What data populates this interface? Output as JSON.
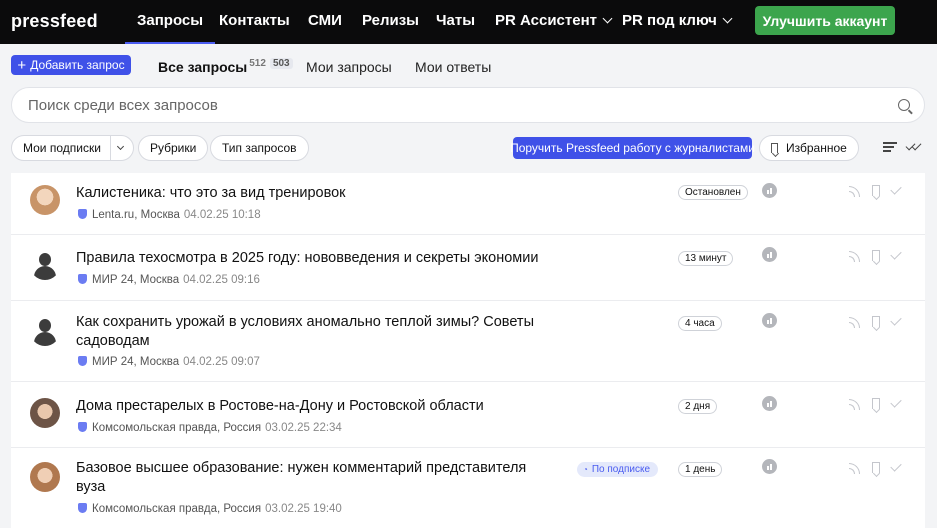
{
  "app": {
    "logo": "pressfeed"
  },
  "nav": {
    "items": [
      {
        "label": "Запросы",
        "active": true
      },
      {
        "label": "Контакты"
      },
      {
        "label": "СМИ"
      },
      {
        "label": "Релизы"
      },
      {
        "label": "Чаты"
      },
      {
        "label": "PR Ассистент",
        "dropdown": true
      },
      {
        "label": "PR под ключ",
        "dropdown": true
      }
    ],
    "upgrade_label": "Улучшить аккаунт"
  },
  "subbar": {
    "add_label": "Добавить запрос",
    "tabs": [
      {
        "label": "Все запросы",
        "count": "512",
        "badge": "503",
        "active": true
      },
      {
        "label": "Мои запросы"
      },
      {
        "label": "Мои ответы"
      }
    ]
  },
  "search": {
    "placeholder": "Поиск среди всех запросов",
    "value": ""
  },
  "filters": {
    "subscriptions": "Мои подписки",
    "rubrics": "Рубрики",
    "type": "Тип запросов",
    "promo": "Поручить Pressfeed работу с журналистами",
    "favorites": "Избранное"
  },
  "colors": {
    "accent": "#3f51e8",
    "upgrade": "#3ca54d",
    "nav_bg": "#0b0b0c"
  },
  "requests": [
    {
      "title": "Калистеника: что это за вид тренировок",
      "source": "Lenta.ru, Москва",
      "date": "04.02.25 10:18",
      "status": "Остановлен",
      "avatar": "photo"
    },
    {
      "title": "Правила техосмотра в 2025 году: нововведения и секреты экономии",
      "source": "МИР 24, Москва",
      "date": "04.02.25 09:16",
      "status": "13 минут",
      "avatar": "silhouette"
    },
    {
      "title": "Как сохранить урожай в условиях аномально теплой зимы? Советы садоводам",
      "source": "МИР 24, Москва",
      "date": "04.02.25 09:07",
      "status": "4 часа",
      "avatar": "silhouette"
    },
    {
      "title": "Дома престарелых в Ростове-на-Дону и Ростовской области",
      "source": "Комсомольская правда, Россия",
      "date": "03.02.25 22:34",
      "status": "2 дня",
      "avatar": "photo2"
    },
    {
      "title": "Базовое высшее образование: нужен комментарий представителя вуза",
      "source": "Комсомольская правда, Россия",
      "date": "03.02.25 19:40",
      "status": "1 день",
      "tag": "По подписке",
      "avatar": "photo3"
    }
  ]
}
